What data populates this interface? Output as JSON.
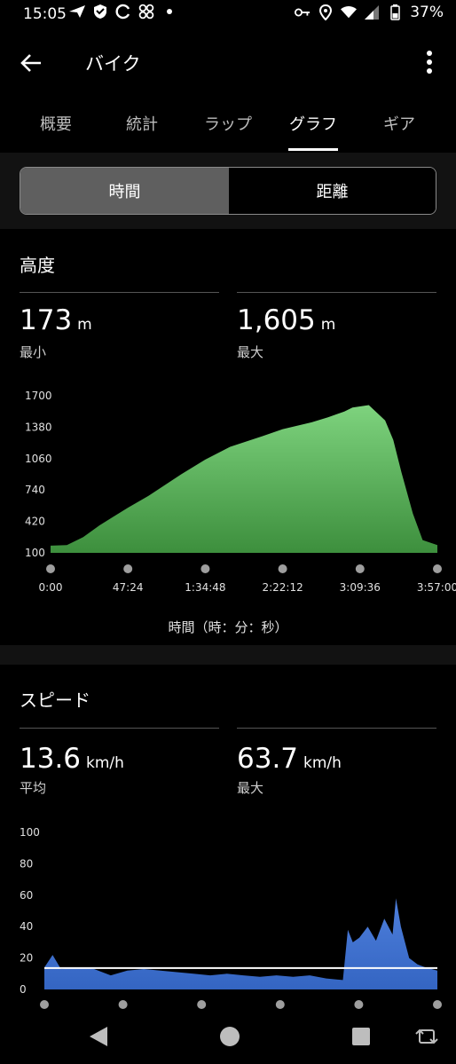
{
  "status": {
    "time": "15:05",
    "battery": "37%"
  },
  "appbar": {
    "title": "バイク",
    "back_icon": "arrow-back-icon",
    "more_icon": "more-vert-icon"
  },
  "tabs": [
    {
      "label": "概要",
      "active": false
    },
    {
      "label": "統計",
      "active": false
    },
    {
      "label": "ラップ",
      "active": false
    },
    {
      "label": "グラフ",
      "active": true
    },
    {
      "label": "ギア",
      "active": false
    }
  ],
  "segment": {
    "time": "時間",
    "distance": "距離",
    "selected": "time"
  },
  "altitude": {
    "title": "高度",
    "min_value": "173",
    "min_unit": "m",
    "min_label": "最小",
    "max_value": "1,605",
    "max_unit": "m",
    "max_label": "最大",
    "xlabel": "時間（時：分：秒）"
  },
  "speed": {
    "title": "スピード",
    "avg_value": "13.6",
    "avg_unit": "km/h",
    "avg_label": "平均",
    "max_value": "63.7",
    "max_unit": "km/h",
    "max_label": "最大"
  },
  "colors": {
    "altitude_fill": "#4a9d4a",
    "speed_fill": "#3f6fc9",
    "avg_line": "#ffffff"
  },
  "chart_data": [
    {
      "type": "area",
      "yticks": [
        "1700",
        "1380",
        "1060",
        "740",
        "420",
        "100"
      ],
      "ylim": [
        100,
        1700
      ],
      "xticks": [
        "0:00",
        "47:24",
        "1:34:48",
        "2:22:12",
        "3:09:36",
        "3:57:00"
      ],
      "x_minutes": [
        0,
        10,
        20,
        30,
        47.4,
        60,
        80,
        94.8,
        110,
        130,
        142.2,
        160,
        170,
        180,
        185,
        195,
        205,
        210,
        215,
        222,
        228,
        237
      ],
      "y": [
        173,
        180,
        260,
        380,
        560,
        680,
        900,
        1050,
        1180,
        1290,
        1360,
        1430,
        1480,
        1540,
        1580,
        1605,
        1450,
        1250,
        920,
        500,
        230,
        180
      ]
    },
    {
      "type": "area",
      "yticks": [
        "100",
        "80",
        "60",
        "40",
        "20",
        "0"
      ],
      "ylim": [
        0,
        100
      ],
      "average": 13.6,
      "x_minutes": [
        0,
        5,
        10,
        20,
        30,
        40,
        50,
        60,
        70,
        80,
        90,
        100,
        110,
        120,
        130,
        140,
        150,
        160,
        170,
        180,
        183,
        186,
        190,
        195,
        200,
        205,
        210,
        212,
        215,
        220,
        225,
        230,
        237
      ],
      "y": [
        14,
        22,
        13,
        14,
        13,
        9,
        12,
        13,
        12,
        11,
        10,
        9,
        10,
        9,
        8,
        9,
        8,
        9,
        7,
        6,
        38,
        30,
        33,
        40,
        31,
        45,
        35,
        58,
        40,
        20,
        16,
        14,
        12
      ]
    }
  ]
}
